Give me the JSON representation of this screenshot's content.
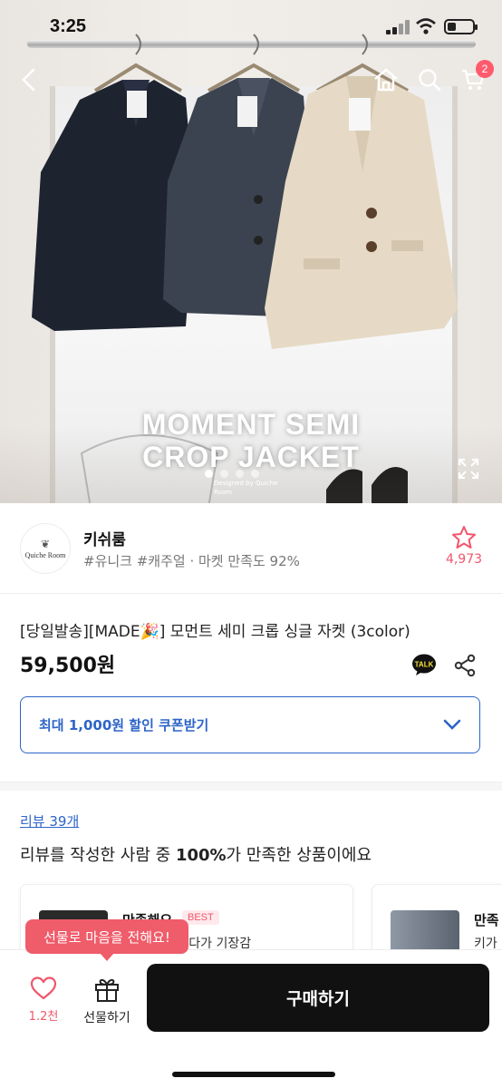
{
  "status_bar": {
    "time": "3:25"
  },
  "hero": {
    "title_line1": "MOMENT SEMI",
    "title_line2": "CROP JACKET",
    "subtitle": "Designed by Quiche Room",
    "cart_count": "2",
    "slide_dots": 4,
    "active_slide": 1
  },
  "seller": {
    "logo_text": "Quiche Room",
    "name": "키쉬룸",
    "tags": "#유니크 #캐주얼 · 마켓 만족도 92%",
    "favorite_count": "4,973"
  },
  "product": {
    "name": "[당일발송][MADE🎉] 모먼트 세미 크롭 싱글 자켓 (3color)",
    "price": "59,500원",
    "talk_label": "TALK",
    "coupon_label": "최대 1,000원 할인 쿠폰받기"
  },
  "reviews": {
    "link_label": "리뷰 39개",
    "summary_prefix": "리뷰를 작성한 사람 중 ",
    "summary_percent": "100%",
    "summary_suffix": "가 만족한 상품이에요",
    "cards": [
      {
        "title": "만족해요",
        "badge": "BEST",
        "snippet": "을 찾아 헤매다가 기장감"
      },
      {
        "title": "만족",
        "snippet": "키가"
      }
    ]
  },
  "bottom_bar": {
    "tooltip": "선물로 마음을 전해요!",
    "like_count": "1.2천",
    "gift_label": "선물하기",
    "buy_label": "구매하기"
  },
  "colors": {
    "accent_blue": "#2d64c8",
    "accent_pink": "#f0566b",
    "buy_button": "#111111"
  }
}
